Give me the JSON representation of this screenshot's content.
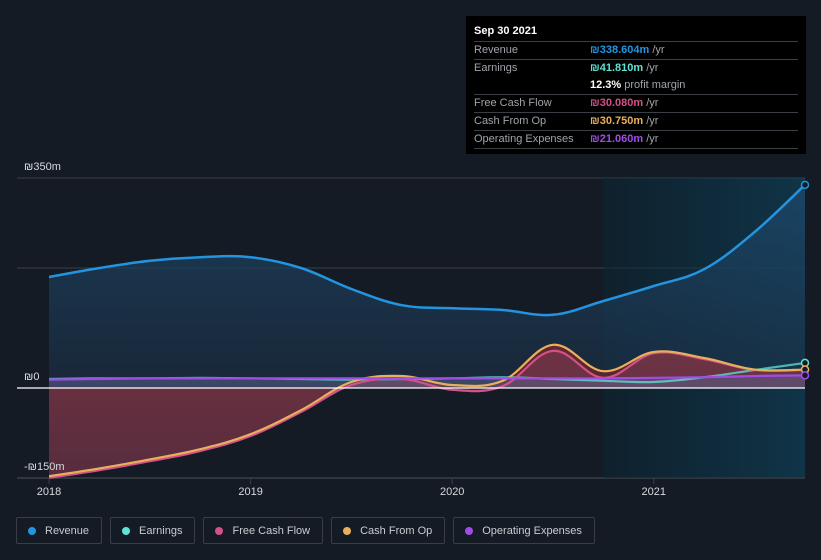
{
  "tooltip": {
    "date": "Sep 30 2021",
    "rows": [
      {
        "label": "Revenue",
        "value": "₪338.604m",
        "unit": " /yr",
        "color": "#2394df"
      },
      {
        "label": "Earnings",
        "value": "₪41.810m",
        "unit": " /yr",
        "color": "#5fe3d4"
      },
      {
        "label": "",
        "value": "12.3%",
        "unit": " profit margin",
        "color": "#ffffff"
      },
      {
        "label": "Free Cash Flow",
        "value": "₪30.080m",
        "unit": " /yr",
        "color": "#d4508a"
      },
      {
        "label": "Cash From Op",
        "value": "₪30.750m",
        "unit": " /yr",
        "color": "#e8b05a"
      },
      {
        "label": "Operating Expenses",
        "value": "₪21.060m",
        "unit": " /yr",
        "color": "#a04de8"
      }
    ]
  },
  "legend": [
    {
      "label": "Revenue",
      "color": "#2394df"
    },
    {
      "label": "Earnings",
      "color": "#5fe3d4"
    },
    {
      "label": "Free Cash Flow",
      "color": "#d4508a"
    },
    {
      "label": "Cash From Op",
      "color": "#e8b05a"
    },
    {
      "label": "Operating Expenses",
      "color": "#a04de8"
    }
  ],
  "chart_data": {
    "type": "area",
    "title": "",
    "xlabel": "",
    "ylabel": "",
    "currency_unit": "₪ millions",
    "ylim": [
      -150,
      350
    ],
    "y_tick_labels": [
      "₪350m",
      "₪0",
      "-₪150m"
    ],
    "y_ticks": [
      350,
      0,
      -150
    ],
    "x_tick_labels": [
      "2018",
      "2019",
      "2020",
      "2021"
    ],
    "x_ticks": [
      2018.0,
      2019.0,
      2020.0,
      2021.0
    ],
    "xlim": [
      2018.0,
      2021.75
    ],
    "highlight_from": 2020.75,
    "grid": true,
    "legend_position": "bottom-left",
    "x": [
      2018.0,
      2018.25,
      2018.5,
      2018.75,
      2019.0,
      2019.25,
      2019.5,
      2019.75,
      2020.0,
      2020.25,
      2020.5,
      2020.75,
      2021.0,
      2021.25,
      2021.5,
      2021.75
    ],
    "series": [
      {
        "name": "Revenue",
        "color": "#2394df",
        "values": [
          185,
          200,
          212,
          218,
          218,
          200,
          165,
          138,
          133,
          130,
          122,
          145,
          170,
          198,
          260,
          338.6
        ]
      },
      {
        "name": "Earnings",
        "color": "#5fe3d4",
        "values": [
          15,
          16,
          16,
          17,
          16,
          15,
          14,
          15,
          16,
          18,
          15,
          12,
          10,
          18,
          30,
          41.8
        ]
      },
      {
        "name": "Free Cash Flow",
        "color": "#d4508a",
        "values": [
          -150,
          -137,
          -122,
          -105,
          -80,
          -40,
          5,
          15,
          -3,
          3,
          62,
          17,
          58,
          48,
          30.1,
          30.1
        ]
      },
      {
        "name": "Cash From Op",
        "color": "#e8b05a",
        "values": [
          -147,
          -134,
          -119,
          -102,
          -77,
          -37,
          10,
          20,
          5,
          12,
          72,
          28,
          60,
          50,
          30.75,
          30.75
        ]
      },
      {
        "name": "Operating Expenses",
        "color": "#a04de8",
        "values": [
          14,
          15,
          16,
          16,
          16,
          16,
          16,
          16,
          16,
          16,
          16,
          16,
          17,
          18,
          20,
          21.06
        ]
      }
    ]
  }
}
